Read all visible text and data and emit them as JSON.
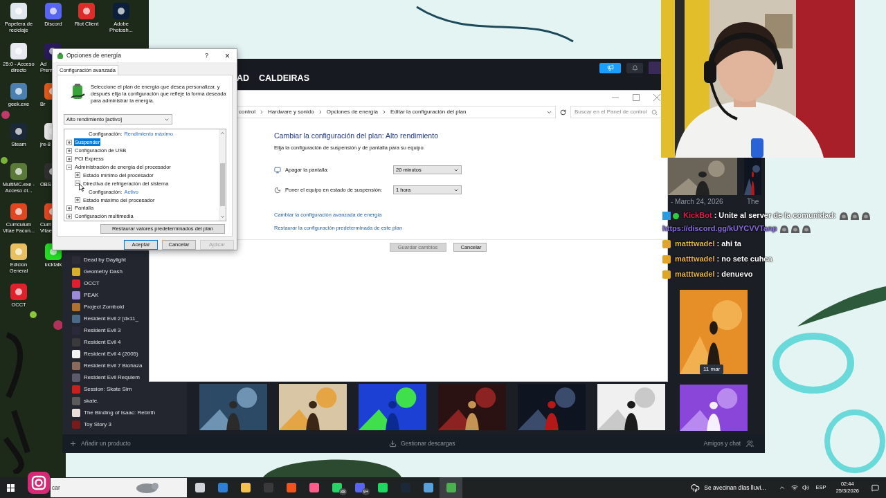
{
  "desktop_icons": [
    [
      {
        "label": "Papelera de reciclaje"
      },
      {
        "label": "Discord"
      },
      {
        "label": "Riot Client"
      },
      {
        "label": "Adobe Photosh..."
      }
    ],
    [
      {
        "label": "25:0 - Acceso directo"
      },
      {
        "label": "Ad Premi"
      }
    ],
    [
      {
        "label": "geek.exe"
      },
      {
        "label": "Br"
      }
    ],
    [
      {
        "label": "Steam"
      },
      {
        "label": "jre-8"
      }
    ],
    [
      {
        "label": "MultiMC.exe - Acceso di..."
      },
      {
        "label": "OBS"
      }
    ],
    [
      {
        "label": "Curriculum Vitae Facun..."
      },
      {
        "label": "Curri Vitae"
      }
    ],
    [
      {
        "label": "Edicion General"
      },
      {
        "label": "kicktalk"
      }
    ],
    [
      {
        "label": "OCCT"
      }
    ]
  ],
  "steam": {
    "nav": [
      "AD",
      "CALDEIRAS"
    ],
    "games": [
      "Dead by Daylight",
      "Geometry Dash",
      "OCCT",
      "PEAK",
      "Project Zomboid",
      "Resident Evil 2 [dx11_",
      "Resident Evil 3",
      "Resident Evil 4",
      "Resident Evil 4 (2005)",
      "Resident Evil 7 Biohaza",
      "Resident Evil Requiem",
      "Session: Skate Sim",
      "skate.",
      "The Binding of Isaac: Rebirth",
      "Toy Story 3"
    ],
    "news_date": "- March 24, 2026",
    "news_next": "The",
    "tile_date": "11 mar",
    "bottom": {
      "add": "Añadir un producto",
      "downloads": "Gestionar descargas",
      "friends": "Amigos y chat"
    }
  },
  "control_panel": {
    "breadcrumb": [
      "control",
      "Hardware y sonido",
      "Opciones de energía",
      "Editar la configuración del plan"
    ],
    "search_placeholder": "Buscar en el Panel de control",
    "title": "Cambiar la configuración del plan: Alto rendimiento",
    "subtitle": "Elija la configuración de suspensión y de pantalla para su equipo.",
    "settings": [
      {
        "kind": "display",
        "label": "Apagar la pantalla:",
        "value": "20 minutos"
      },
      {
        "kind": "sleep",
        "label": "Poner el equipo en estado de suspensión:",
        "value": "1 hora"
      }
    ],
    "links": [
      "Cambiar la configuración avanzada de energía",
      "Restaurar la configuración predeterminada de este plan"
    ],
    "buttons": [
      {
        "label": "Guardar cambios",
        "disabled": true
      },
      {
        "label": "Cancelar",
        "disabled": false
      }
    ]
  },
  "power_dialog": {
    "title": "Opciones de energía",
    "help": "?",
    "close": "×",
    "tab": "Configuración avanzada",
    "intro": "Seleccione el plan de energía que desea personalizar, y después elija la configuración que refleje la forma deseada para administrar la energía.",
    "plan": "Alto rendimiento [activo]",
    "tree": {
      "scrolled_setting": {
        "label": "Configuración:",
        "value": "Rendimiento máximo"
      },
      "items": [
        {
          "kind": "node",
          "label": "Suspender",
          "expanded": false,
          "selected": true
        },
        {
          "kind": "node",
          "label": "Configuración de USB",
          "expanded": false,
          "selected": false
        },
        {
          "kind": "node",
          "label": "PCI Express",
          "expanded": false,
          "selected": false
        },
        {
          "kind": "node",
          "label": "Administración de energía del procesador",
          "expanded": true,
          "selected": false,
          "children": [
            {
              "kind": "node",
              "label": "Estado mínimo del procesador",
              "expanded": false,
              "selected": false
            },
            {
              "kind": "node",
              "label": "Directiva de refrigeración del sistema",
              "expanded": true,
              "selected": false,
              "children": [
                {
                  "kind": "setting",
                  "label": "Configuración:",
                  "value": "Activo"
                }
              ]
            },
            {
              "kind": "node",
              "label": "Estado máximo del procesador",
              "expanded": false,
              "selected": false
            }
          ]
        },
        {
          "kind": "node",
          "label": "Pantalla",
          "expanded": false,
          "selected": false
        },
        {
          "kind": "node",
          "label": "Configuración multimedia",
          "expanded": false,
          "selected": false
        }
      ]
    },
    "restore": "Restaurar valores predeterminados del plan",
    "buttons": [
      {
        "label": "Aceptar",
        "default": true,
        "disabled": false
      },
      {
        "label": "Cancelar",
        "default": false,
        "disabled": false
      },
      {
        "label": "Aplicar",
        "default": false,
        "disabled": true
      }
    ]
  },
  "chat": [
    {
      "kind": "bot",
      "user": "KickBot",
      "color": "#e41b4a",
      "parts": [
        {
          "kind": "text",
          "text": ": Unite al server de la comunidad:"
        },
        {
          "kind": "emote"
        },
        {
          "kind": "emote"
        },
        {
          "kind": "emote"
        },
        {
          "kind": "link",
          "text": "https://discord.gg/kUYCVVTanp"
        },
        {
          "kind": "emote"
        },
        {
          "kind": "emote"
        },
        {
          "kind": "emote"
        }
      ]
    },
    {
      "kind": "sub",
      "user": "matttwadel",
      "color": "#e9b949",
      "parts": [
        {
          "kind": "text",
          "text": ": ahi ta"
        }
      ]
    },
    {
      "kind": "sub",
      "user": "matttwadel",
      "color": "#e9b949",
      "parts": [
        {
          "kind": "text",
          "text": ": no sete cuhca"
        }
      ]
    },
    {
      "kind": "sub",
      "user": "matttwadel",
      "color": "#e9b949",
      "parts": [
        {
          "kind": "text",
          "text": ": denuevo"
        }
      ]
    }
  ],
  "taskbar": {
    "search": "car",
    "apps": [
      {
        "active": false
      },
      {
        "active": false
      },
      {
        "active": false
      },
      {
        "active": false
      },
      {
        "active": false
      },
      {
        "active": false
      },
      {
        "active": false,
        "badge": "88"
      },
      {
        "active": false,
        "badge": "9+"
      },
      {
        "active": false
      },
      {
        "active": false
      },
      {
        "active": false
      },
      {
        "active": true
      }
    ],
    "weather": "Se avecinan días lluvi...",
    "language": "ESP",
    "time": "02:44",
    "date": "25/3/2026"
  }
}
